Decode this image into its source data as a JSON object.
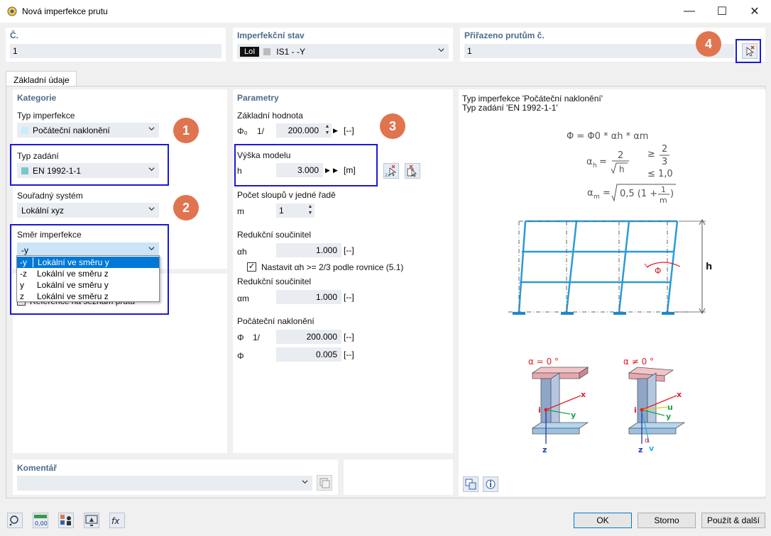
{
  "window": {
    "title": "Nová imperfekce prutu",
    "minimize": "—",
    "maximize": "☐",
    "close": "✕"
  },
  "header": {
    "no_label": "Č.",
    "no_value": "1",
    "case_label": "Imperfekční stav",
    "case_tag": "LoI",
    "case_value": "IS1 - -Y",
    "assigned_label": "Přiřazeno prutům č.",
    "assigned_value": "1"
  },
  "tab": {
    "label": "Základní údaje"
  },
  "category": {
    "title": "Kategorie",
    "type_label": "Typ imperfekce",
    "type_value": "Počáteční naklonění",
    "input_label": "Typ zadání",
    "input_value": "EN 1992-1-1",
    "cs_label": "Souřadný systém",
    "cs_value": "Lokální xyz",
    "dir_label": "Směr imperfekce",
    "dir_value": "-y",
    "dir_options": [
      {
        "code": "-y",
        "text": "Lokální ve směru y"
      },
      {
        "code": "-z",
        "text": "Lokální ve směru z"
      },
      {
        "code": "y",
        "text": "Lokální ve směru y"
      },
      {
        "code": "z",
        "text": "Lokální ve směru z"
      }
    ],
    "ref_label": "Reference na seznam prutů"
  },
  "params": {
    "title": "Parametry",
    "base_label": "Základní hodnota",
    "base_sym": "Φ₀",
    "base_prefix": "1/",
    "base_value": "200.000",
    "base_unit": "[--]",
    "height_label": "Výška modelu",
    "height_sym": "h",
    "height_value": "3.000",
    "height_unit": "[m]",
    "cols_label": "Počet sloupů v jedné řadě",
    "cols_sym": "m",
    "cols_value": "1",
    "red1_label": "Redukční součinitel",
    "red1_sym": "αh",
    "red1_value": "1.000",
    "red1_unit": "[--]",
    "check_label": "Nastavit αh >= 2/3 podle rovnice (5.1)",
    "red2_label": "Redukční součinitel",
    "red2_sym": "αm",
    "red2_value": "1.000",
    "red2_unit": "[--]",
    "init_label": "Počáteční naklonění",
    "init1_sym": "Φ",
    "init1_prefix": "1/",
    "init1_value": "200.000",
    "init1_unit": "[--]",
    "init2_sym": "Φ",
    "init2_value": "0.005",
    "init2_unit": "[--]"
  },
  "info": {
    "line1": "Typ imperfekce 'Počáteční naklonění'",
    "line2": "Typ zadání 'EN 1992-1-1'",
    "formula1": "Φ = Φ0 * αh * αm",
    "alpha0": "α = 0 °",
    "alphane0": "α ≠ 0 °",
    "h_label": "h",
    "phi_label": "Φ"
  },
  "comment": {
    "label": "Komentář"
  },
  "badges": [
    "1",
    "2",
    "3",
    "4"
  ],
  "footer": {
    "ok": "OK",
    "cancel": "Storno",
    "apply_next": "Použít & další"
  },
  "colors": {
    "accent": "#1a1ad6",
    "badge": "#e0744f",
    "title_blue": "#4d6b8c",
    "frame_blue": "#2a9bd8"
  }
}
